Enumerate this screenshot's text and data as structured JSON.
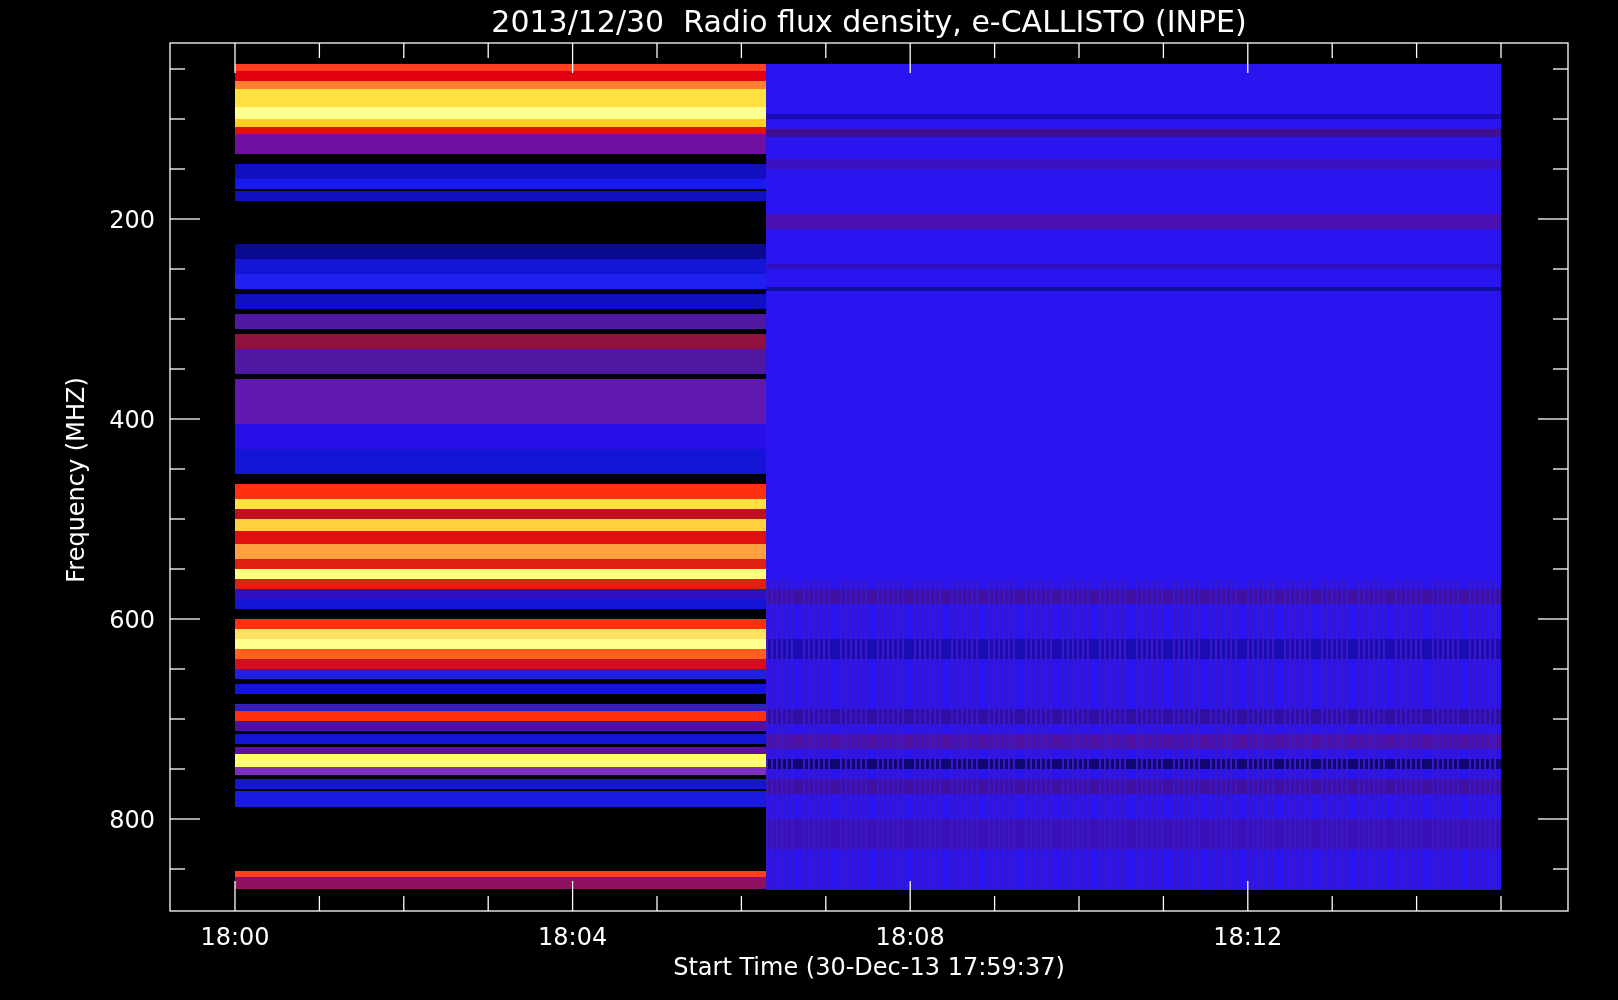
{
  "title": "2013/12/30  Radio flux density, e-CALLISTO (INPE)",
  "y_axis": {
    "label": "Frequency (MHZ)",
    "ticks": [
      "200",
      "400",
      "600",
      "800"
    ]
  },
  "x_axis": {
    "label": "Start Time (30-Dec-13 17:59:37)",
    "ticks": [
      "18:00",
      "18:04",
      "18:08",
      "18:12"
    ]
  }
}
